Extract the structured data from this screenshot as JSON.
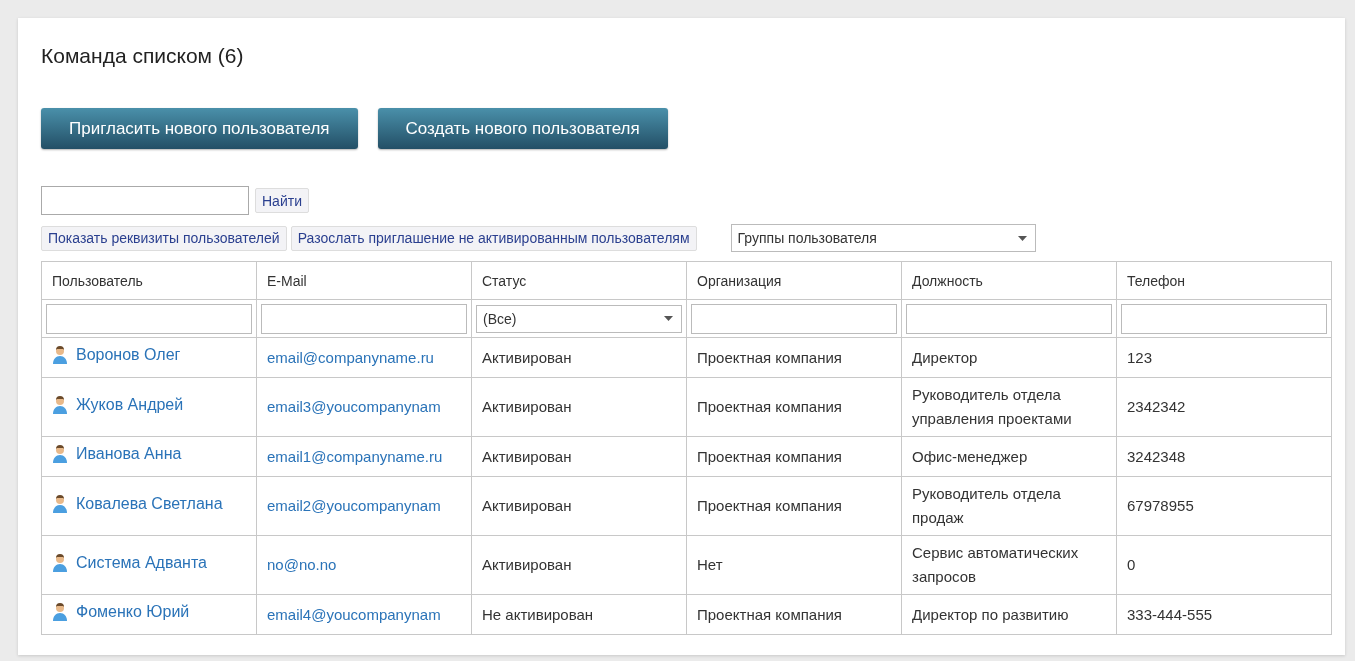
{
  "title": "Команда списком (6)",
  "actions": [
    "Пригласить нового пользователя",
    "Создать нового пользователя"
  ],
  "search": {
    "button": "Найти"
  },
  "links": [
    "Показать реквизиты пользователей",
    "Разослать приглашение не активированным пользователям"
  ],
  "group_select": {
    "value": "Группы пользователя"
  },
  "table": {
    "columns": [
      {
        "label": "Пользователь",
        "kind": "text"
      },
      {
        "label": "E-Mail",
        "kind": "text"
      },
      {
        "label": "Статус",
        "kind": "select",
        "value": "(Все)"
      },
      {
        "label": "Организация",
        "kind": "text"
      },
      {
        "label": "Должность",
        "kind": "text"
      },
      {
        "label": "Телефон",
        "kind": "text"
      }
    ],
    "rows": [
      {
        "user": "Воронов Олег",
        "email": "email@companyname.ru",
        "status": "Активирован",
        "org": "Проектная компания",
        "position": "Директор",
        "phone": "123"
      },
      {
        "user": "Жуков Андрей",
        "email": "email3@youcompanynam",
        "status": "Активирован",
        "org": "Проектная компания",
        "position": "Руководитель отдела управления проектами",
        "phone": "2342342"
      },
      {
        "user": "Иванова Анна",
        "email": "email1@companyname.ru",
        "status": "Активирован",
        "org": "Проектная компания",
        "position": "Офис-менеджер",
        "phone": "3242348"
      },
      {
        "user": "Ковалева Светлана",
        "email": "email2@youcompanynam",
        "status": "Активирован",
        "org": "Проектная компания",
        "position": "Руководитель отдела продаж",
        "phone": "67978955"
      },
      {
        "user": "Система Адванта",
        "email": "no@no.no",
        "status": "Активирован",
        "org": "Нет",
        "position": "Сервис автоматических запросов",
        "phone": "0"
      },
      {
        "user": "Фоменко Юрий",
        "email": "email4@youcompanynam",
        "status": "Не активирован",
        "org": "Проектная компания",
        "position": "Директор по развитию",
        "phone": "333-444-555"
      }
    ]
  }
}
